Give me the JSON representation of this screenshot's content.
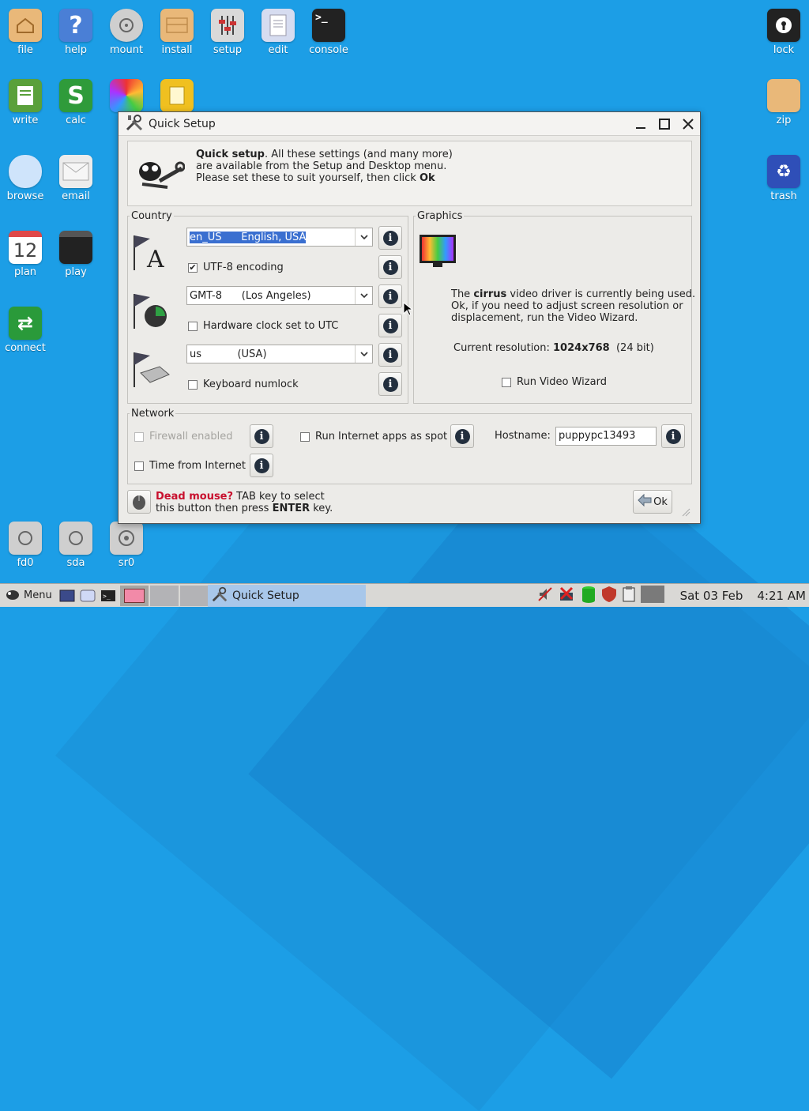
{
  "desktop": {
    "icons_left": [
      {
        "label": "file",
        "icon": "folder-home-icon",
        "color": "#e8b878"
      },
      {
        "label": "help",
        "icon": "help-icon",
        "color": "#4a7fd6"
      },
      {
        "label": "mount",
        "icon": "drive-icon",
        "color": "#cfcfcf"
      },
      {
        "label": "install",
        "icon": "package-icon",
        "color": "#e8b878"
      },
      {
        "label": "setup",
        "icon": "setup-sliders-icon",
        "color": "#d8d8d8"
      },
      {
        "label": "edit",
        "icon": "edit-icon",
        "color": "#d6dcf0"
      },
      {
        "label": "console",
        "icon": "console-icon",
        "color": "#222222"
      },
      {
        "label": "write",
        "icon": "write-icon",
        "color": "#5aa03a"
      },
      {
        "label": "calc",
        "icon": "calc-icon",
        "color": "#2f9b3a"
      },
      {
        "label": "browse",
        "icon": "cloud-icon",
        "color": "#cfe4fb"
      },
      {
        "label": "email",
        "icon": "email-icon",
        "color": "#e8e8e8"
      },
      {
        "label": "plan",
        "icon": "calendar-icon",
        "color": "#ffffff"
      },
      {
        "label": "play",
        "icon": "clapper-icon",
        "color": "#222222"
      },
      {
        "label": "connect",
        "icon": "connect-icon",
        "color": "#2a9a3a"
      },
      {
        "label": "fd0",
        "icon": "drive-icon",
        "color": "#cfcfcf"
      },
      {
        "label": "sda",
        "icon": "drive-icon",
        "color": "#cfcfcf"
      },
      {
        "label": "sr0",
        "icon": "optical-drive-icon",
        "color": "#cfcfcf"
      }
    ],
    "icons_right": [
      {
        "label": "lock",
        "icon": "lock-icon",
        "color": "#222222"
      },
      {
        "label": "zip",
        "icon": "zip-icon",
        "color": "#e8b878"
      },
      {
        "label": "trash",
        "icon": "trash-icon",
        "color": "#2f4fb8"
      }
    ],
    "calendar_day": "12",
    "calc_glyph": "S",
    "help_glyph": "?",
    "console_glyph": ">_"
  },
  "window": {
    "title": "Quick Setup",
    "banner": {
      "bold": "Quick setup",
      "line1": ". All these settings (and many more)",
      "line2": "are available from the Setup and Desktop menu.",
      "line3": "Please set these to suit yourself, then click ",
      "line3_bold": "Ok"
    },
    "country": {
      "legend": "Country",
      "locale_value": "en_US      English, USA",
      "utf8_label": "UTF-8 encoding",
      "utf8_checked": true,
      "timezone_value": "GMT-8      (Los Angeles)",
      "hwclock_label": "Hardware clock set to UTC",
      "hwclock_checked": false,
      "keyboard_value": "us           (USA)",
      "numlock_label": "Keyboard numlock",
      "numlock_checked": false
    },
    "graphics": {
      "legend": "Graphics",
      "msg_pre": "The ",
      "driver": "cirrus",
      "msg_post": " video driver is currently being used.",
      "msg_line2": "Ok, if you need to adjust screen resolution or",
      "msg_line3": "displacement, run the Video Wizard.",
      "res_label": "Current resolution: ",
      "res_value": "1024x768",
      "res_bits": "  (24 bit)",
      "wizard_label": "Run Video Wizard",
      "wizard_checked": false
    },
    "network": {
      "legend": "Network",
      "firewall_label": "Firewall enabled",
      "spot_label": "Run Internet apps as spot",
      "hostname_label": "Hostname:",
      "hostname_value": "puppypc13493",
      "time_label": "Time from Internet"
    },
    "footer": {
      "dead": "Dead mouse?",
      "text1": " TAB key to select",
      "line2_pre": "this button then press ",
      "enter": "ENTER",
      "line2_post": " key.",
      "ok_label": "Ok"
    },
    "info_glyph": "i"
  },
  "taskbar": {
    "menu_label": "Menu",
    "task_label": "Quick Setup",
    "date": "Sat 03 Feb",
    "time": "4:21 AM"
  }
}
